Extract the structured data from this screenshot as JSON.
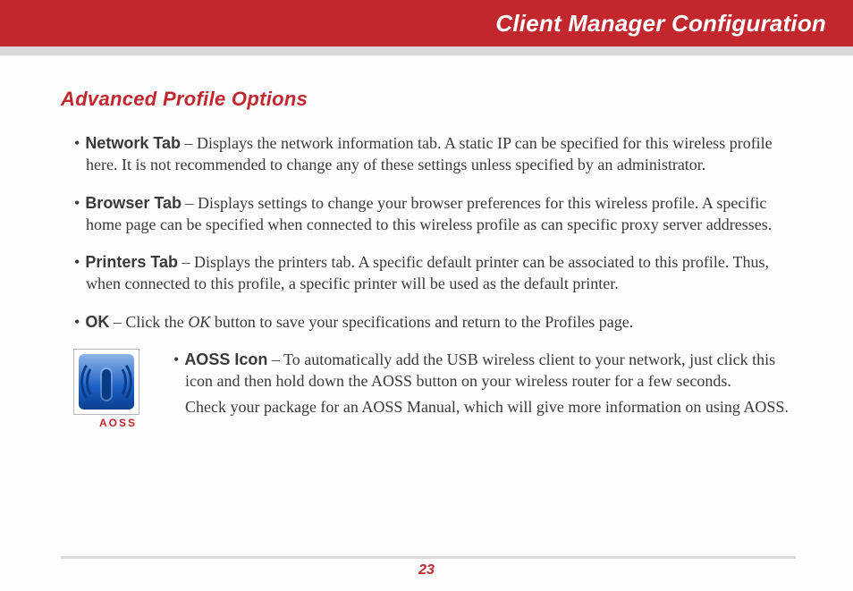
{
  "header": {
    "title": "Client Manager Configuration"
  },
  "section_heading": "Advanced Profile Options",
  "bullets": {
    "network": {
      "term": "Network Tab",
      "body": " –  Displays the network information tab.  A static IP can be specified for this wireless profile here.  It is not recommended to change any of these settings unless specified by an administrator."
    },
    "browser": {
      "term": "Browser Tab",
      "body": " –  Displays settings to change your browser preferences for this wireless profile.  A specific home page can be specified when connected to this wireless profile as can specific proxy server addresses."
    },
    "printers": {
      "term": "Printers Tab",
      "body": " –  Displays the printers tab.  A specific default printer can be associated to this profile.  Thus, when connected to this profile, a specific printer will be used as the default printer."
    },
    "ok": {
      "term": "OK",
      "lead": " – Click the ",
      "em": "OK",
      "tail": " button to save your specifications and return to the Profiles page."
    }
  },
  "aoss": {
    "caption": "AOSS",
    "term": "AOSS Icon",
    "body": " –  To automatically add the USB wireless client to your network, just click this icon and then hold down the AOSS button on your wireless router for a few seconds.",
    "followup": "Check your package for an AOSS Manual, which will give more information on using AOSS."
  },
  "page_number": "23"
}
